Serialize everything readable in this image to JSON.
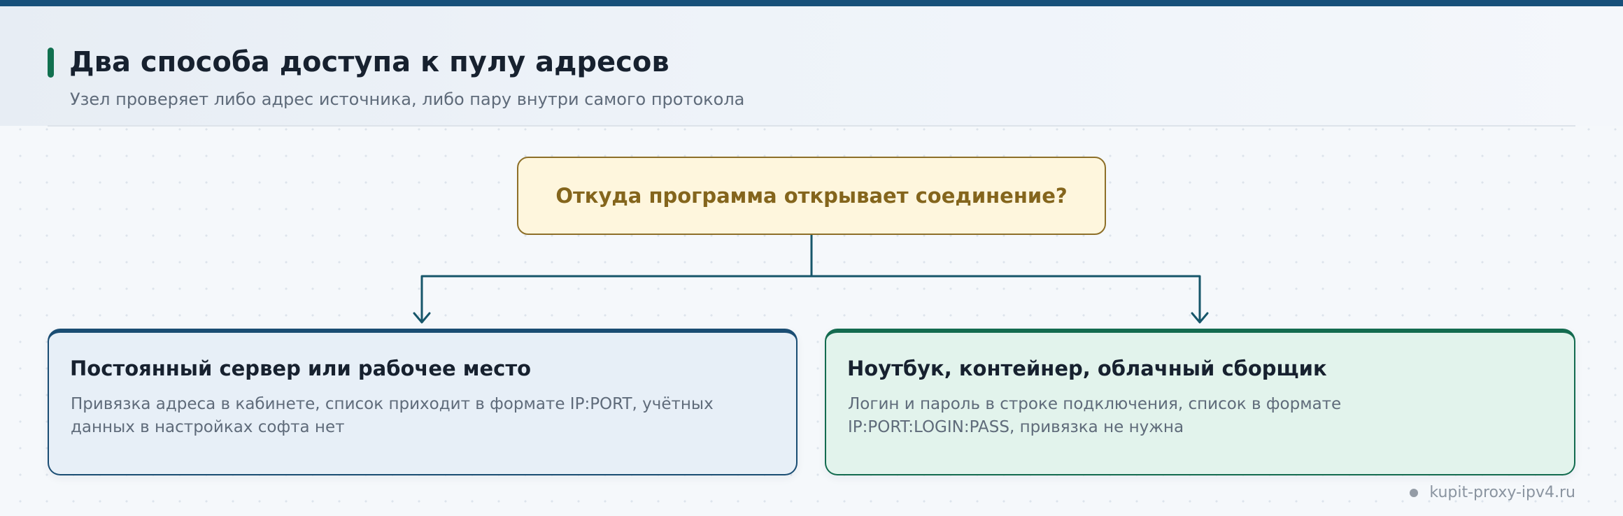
{
  "header": {
    "title": "Два способа доступа к пулу адресов",
    "subtitle": "Узел проверяет либо адрес источника, либо пару внутри самого протокола"
  },
  "decision": {
    "question": "Откуда программа открывает соединение?"
  },
  "options": [
    {
      "title": "Постоянный сервер или рабочее место",
      "description": "Привязка адреса в кабинете, список приходит в формате IP:PORT, учётных данных в настройках софта нет",
      "accent": "#1a4d73"
    },
    {
      "title": "Ноутбук, контейнер, облачный сборщик",
      "description": "Логин и пароль в строке подключения, список в формате IP:PORT:LOGIN:PASS, привязка не нужна",
      "accent": "#136b4f"
    }
  ],
  "footer": {
    "site": "kupit-proxy-ipv4.ru"
  },
  "colors": {
    "top_bar": "#17507a",
    "title_accent": "#11704f",
    "question_border": "#8d6f28",
    "question_fill": "#fef6dd",
    "connector": "#16566a"
  }
}
